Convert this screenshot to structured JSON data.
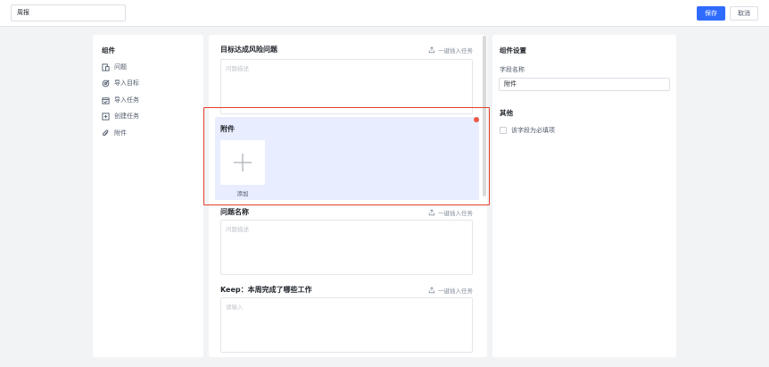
{
  "header": {
    "title_value": "周报",
    "save_label": "保存",
    "cancel_label": "取消"
  },
  "components": {
    "title": "组件",
    "items": [
      {
        "label": "问题",
        "icon": "question-doc-icon"
      },
      {
        "label": "导入目标",
        "icon": "target-icon"
      },
      {
        "label": "导入任务",
        "icon": "task-calendar-icon"
      },
      {
        "label": "创建任务",
        "icon": "add-square-icon"
      },
      {
        "label": "附件",
        "icon": "paperclip-icon"
      }
    ]
  },
  "form": {
    "insert_label": "一键插入任务",
    "sections": [
      {
        "title": "目标达成风险问题",
        "placeholder": "问题描述"
      },
      {
        "title": "问题名称",
        "placeholder": "问题描述"
      },
      {
        "title": "Keep：本周完成了哪些工作",
        "placeholder": "请输入"
      }
    ],
    "attachment": {
      "title": "附件",
      "add_label": "添加"
    }
  },
  "settings": {
    "title": "组件设置",
    "field_name_label": "字段名称",
    "field_name_value": "附件",
    "other_title": "其他",
    "required_label": "该字段为必填项"
  },
  "colors": {
    "primary": "#2f6bff",
    "highlight_border": "#e2402a",
    "selected_block": "#e8eeff"
  }
}
